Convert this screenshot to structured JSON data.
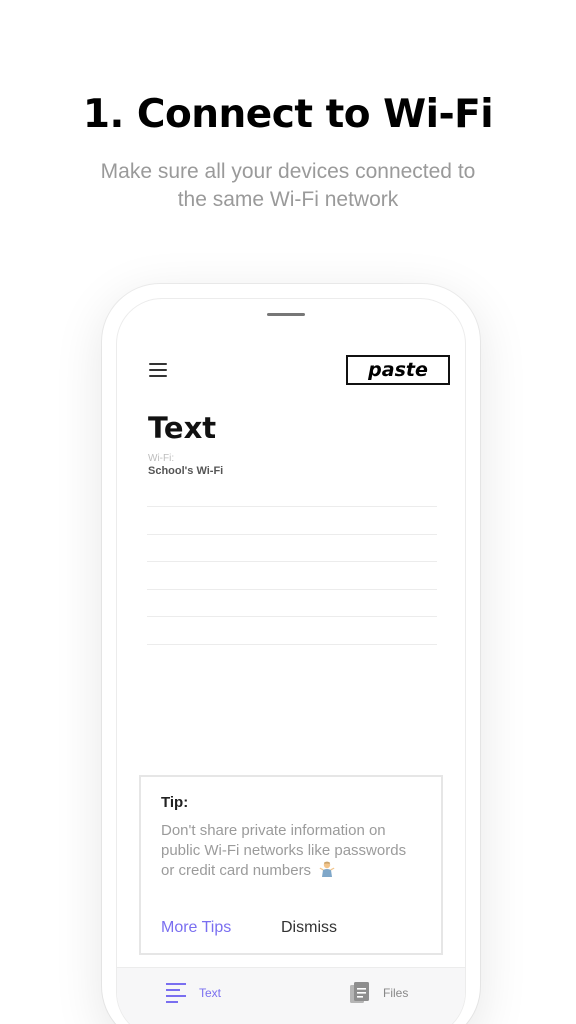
{
  "header": {
    "title": "1. Connect to Wi-Fi",
    "subtitle": "Make sure all your devices connected to the same Wi-Fi network"
  },
  "app": {
    "logo_text": "paste",
    "menu_icon": "hamburger-menu-icon",
    "page_title": "Text",
    "wifi": {
      "label": "Wi-Fi:",
      "value": "School's Wi-Fi"
    }
  },
  "tip": {
    "title": "Tip:",
    "body": "Don't share private information on public Wi-Fi networks like passwords or credit card numbers",
    "emoji_icon": "person-shrugging-emoji",
    "more_tips_label": "More Tips",
    "dismiss_label": "Dismiss"
  },
  "tab_bar": {
    "tabs": [
      {
        "label": "Text",
        "icon": "text-lines-icon",
        "active": true
      },
      {
        "label": "Files",
        "icon": "document-icon",
        "active": false
      }
    ]
  },
  "colors": {
    "accent": "#7a6ff0",
    "subtitle_gray": "#9a9a9a",
    "tip_text_gray": "#9b9b9b"
  }
}
